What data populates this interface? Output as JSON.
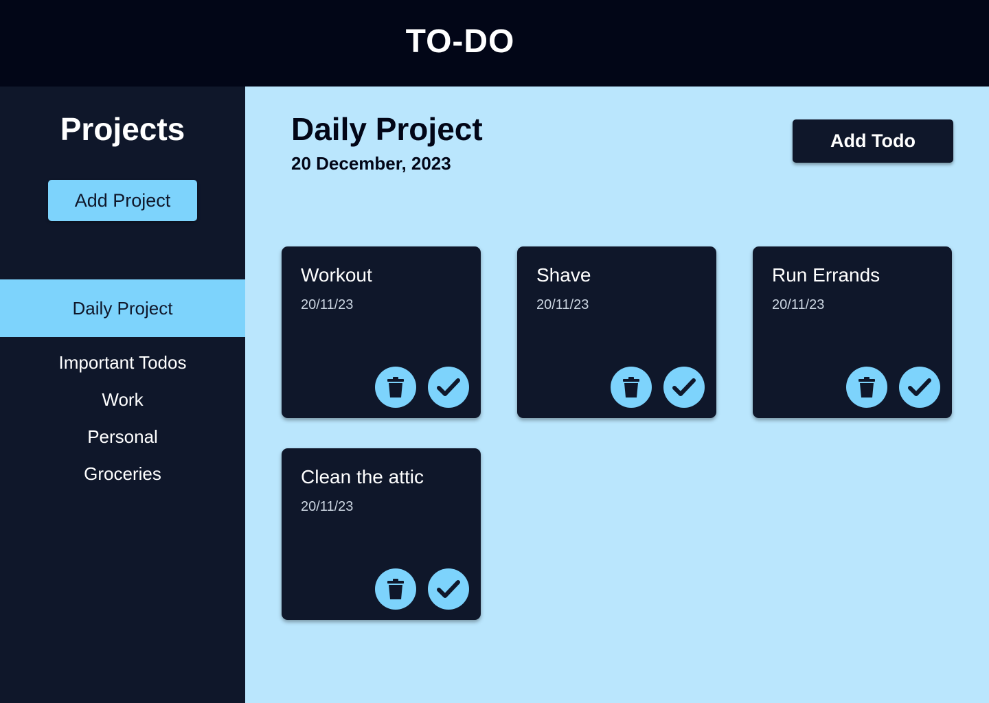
{
  "header": {
    "title": "TO-DO"
  },
  "sidebar": {
    "title": "Projects",
    "add_project_label": "Add Project",
    "projects": [
      {
        "label": "Daily Project",
        "active": true
      },
      {
        "label": "Important Todos",
        "active": false
      },
      {
        "label": "Work",
        "active": false
      },
      {
        "label": "Personal",
        "active": false
      },
      {
        "label": "Groceries",
        "active": false
      }
    ]
  },
  "main": {
    "title": "Daily Project",
    "date": "20 December, 2023",
    "add_todo_label": "Add Todo",
    "todos": [
      {
        "title": "Workout",
        "date": "20/11/23",
        "icons": [
          "trash-icon",
          "check-icon"
        ]
      },
      {
        "title": "Shave",
        "date": "20/11/23",
        "icons": [
          "trash-icon",
          "check-icon"
        ]
      },
      {
        "title": "Run Errands",
        "date": "20/11/23",
        "icons": [
          "trash-icon",
          "check-icon"
        ]
      },
      {
        "title": "Clean the attic",
        "date": "20/11/23",
        "icons": [
          "trash-icon",
          "check-icon"
        ]
      }
    ]
  },
  "colors": {
    "header_bg": "#020617",
    "sidebar_bg": "#0f172a",
    "main_bg": "#bae6fd",
    "accent": "#7dd3fc",
    "card_bg": "#0f172a"
  }
}
